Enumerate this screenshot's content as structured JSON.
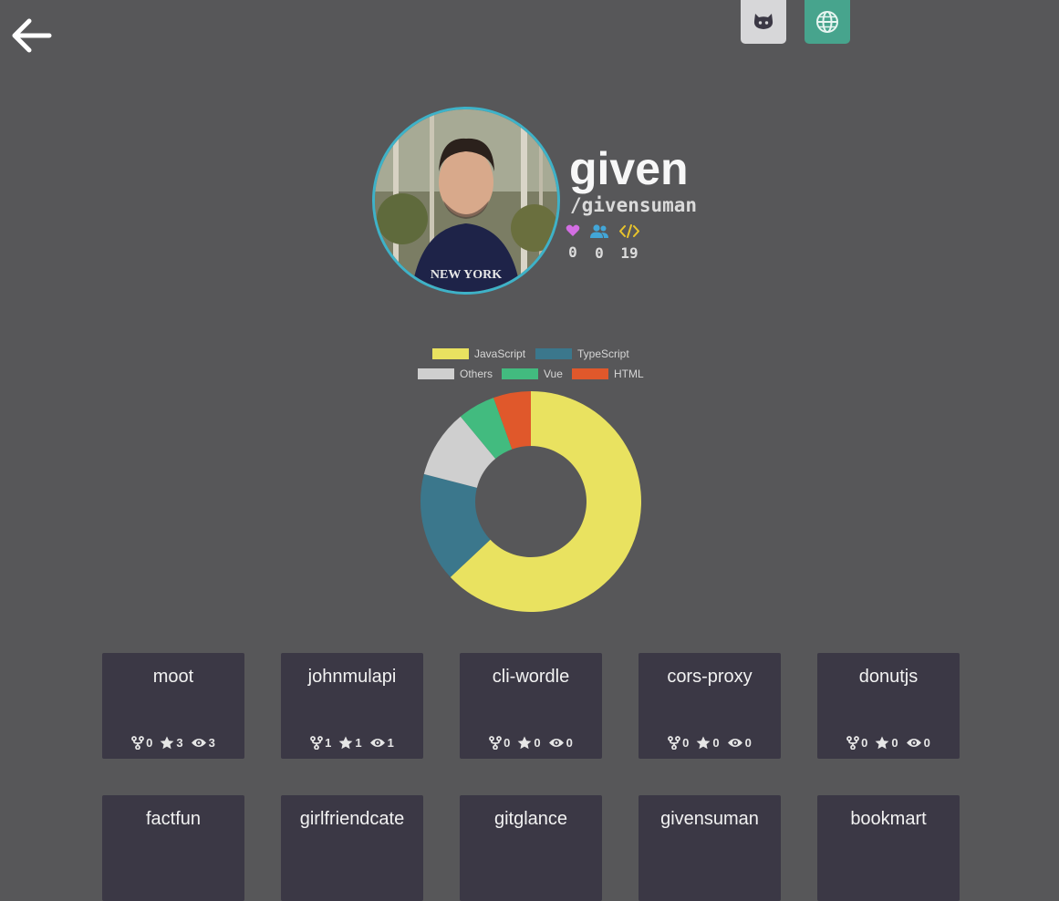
{
  "profile": {
    "name": "given",
    "handle": "/givensuman",
    "stats": {
      "likes": "0",
      "followers": "0",
      "repos": "19"
    }
  },
  "colors": {
    "background": "#575759",
    "card": "#3b3845",
    "avatar_border": "#3eb2c8",
    "web_button": "#47a48d",
    "github_button": "#d7d7d9",
    "heart_icon": "#d36ee3",
    "users_icon": "#42a6d8",
    "code_icon": "#e9c42b"
  },
  "chart_data": {
    "type": "pie",
    "categories": [
      "JavaScript",
      "TypeScript",
      "Others",
      "Vue",
      "HTML"
    ],
    "values": [
      63,
      16,
      10,
      5.5,
      5.5
    ],
    "colors": [
      "#e9e260",
      "#3b778c",
      "#cfcfcf",
      "#42bb7f",
      "#e0582b"
    ],
    "legend_position": "top"
  },
  "repos_row1": [
    {
      "name": "moot",
      "forks": "0",
      "stars": "3",
      "watchers": "3"
    },
    {
      "name": "johnmulapi",
      "forks": "1",
      "stars": "1",
      "watchers": "1"
    },
    {
      "name": "cli-wordle",
      "forks": "0",
      "stars": "0",
      "watchers": "0"
    },
    {
      "name": "cors-proxy",
      "forks": "0",
      "stars": "0",
      "watchers": "0"
    },
    {
      "name": "donutjs",
      "forks": "0",
      "stars": "0",
      "watchers": "0"
    }
  ],
  "repos_row2": [
    {
      "name": "factfun"
    },
    {
      "name": "girlfriendcate"
    },
    {
      "name": "gitglance"
    },
    {
      "name": "givensuman"
    },
    {
      "name": "bookmart"
    }
  ]
}
